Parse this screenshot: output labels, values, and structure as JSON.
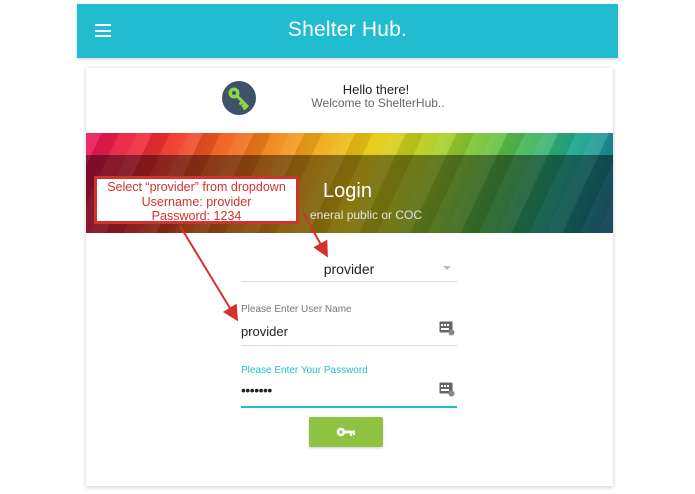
{
  "app": {
    "title": "Shelter Hub."
  },
  "greeting": {
    "title": "Hello there!",
    "subtitle": "Welcome to ShelterHub.."
  },
  "banner": {
    "title": "Login",
    "subtitle": "eneral public or COC"
  },
  "annotation": {
    "line1": "Select “provider” from dropdown",
    "line2": "Username: provider",
    "line3": "Password: 1234"
  },
  "form": {
    "role_select": {
      "value": "provider"
    },
    "username": {
      "label": "Please Enter User Name",
      "value": "provider"
    },
    "password": {
      "label": "Please Enter Your Password",
      "value": "•••••••"
    }
  },
  "colors": {
    "header": "#22bcd1",
    "accent": "#22bcd1",
    "login_button": "#8fc142",
    "annotation": "#d3322c"
  },
  "icons": {
    "menu": "hamburger-icon",
    "avatar": "key-icon",
    "field": "keypad-icon",
    "button": "key-icon"
  }
}
